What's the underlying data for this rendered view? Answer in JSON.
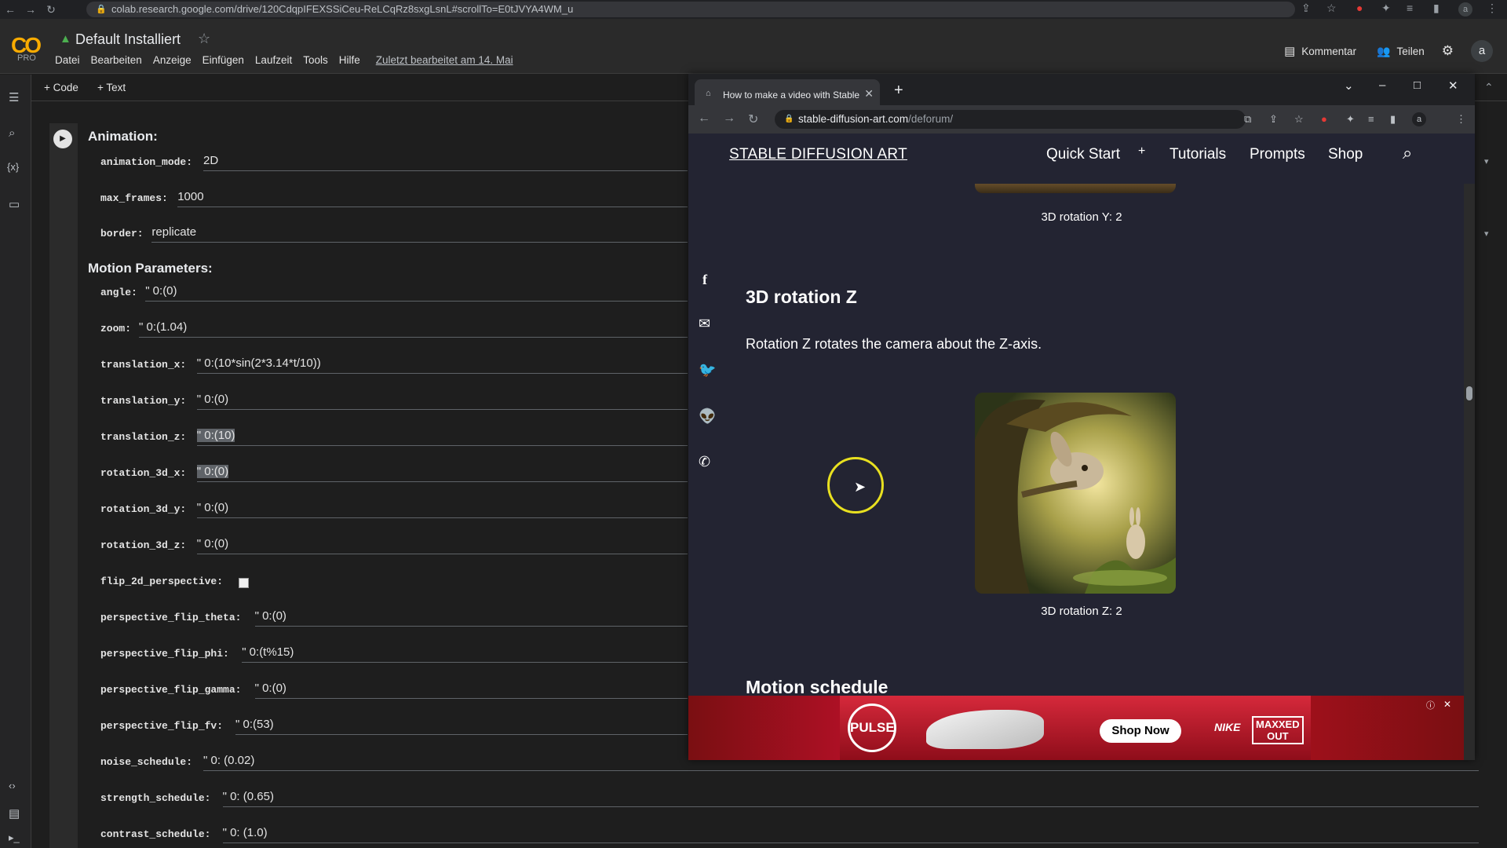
{
  "browser": {
    "url": "colab.research.google.com/drive/120CdqpIFEXSSiCeu-ReLCqRz8sxgLsnL#scrollTo=E0tJVYA4WM_u",
    "profile_initial": "a"
  },
  "colab": {
    "logo": "CO",
    "plan": "PRO",
    "notebook_title": "Default Installiert",
    "menu": [
      "Datei",
      "Bearbeiten",
      "Anzeige",
      "Einfügen",
      "Laufzeit",
      "Tools",
      "Hilfe"
    ],
    "last_edited": "Zuletzt bearbeitet am 14. Mai",
    "comment_label": "Kommentar",
    "share_label": "Teilen",
    "avatar_initial": "a",
    "toolbar": {
      "add_code": "+ Code",
      "add_text": "+ Text"
    }
  },
  "cell": {
    "animation_heading": "Animation:",
    "motion_heading": "Motion Parameters:",
    "animation_params": [
      {
        "name": "animation_mode:",
        "value": "2D"
      },
      {
        "name": "max_frames:",
        "value": "1000"
      },
      {
        "name": "border:",
        "value": "replicate"
      }
    ],
    "motion_params": [
      {
        "name": "angle:",
        "value": "\" 0:(0)"
      },
      {
        "name": "zoom:",
        "value": "\" 0:(1.04)"
      },
      {
        "name": "translation_x:",
        "value": "\" 0:(10*sin(2*3.14*t/10))"
      },
      {
        "name": "translation_y:",
        "value": "\" 0:(0)"
      },
      {
        "name": "translation_z:",
        "value": "\" 0:(10)"
      },
      {
        "name": "rotation_3d_x:",
        "value": "\" 0:(0)"
      },
      {
        "name": "rotation_3d_y:",
        "value": "\" 0:(0)"
      },
      {
        "name": "rotation_3d_z:",
        "value": "\" 0:(0)"
      },
      {
        "name": "flip_2d_perspective:",
        "value": ""
      },
      {
        "name": "perspective_flip_theta:",
        "value": "\" 0:(0)"
      },
      {
        "name": "perspective_flip_phi:",
        "value": "\" 0:(t%15)"
      },
      {
        "name": "perspective_flip_gamma:",
        "value": "\" 0:(0)"
      },
      {
        "name": "perspective_flip_fv:",
        "value": "\" 0:(53)"
      },
      {
        "name": "noise_schedule:",
        "value": "\" 0: (0.02)"
      },
      {
        "name": "strength_schedule:",
        "value": "\" 0: (0.65)"
      },
      {
        "name": "contrast_schedule:",
        "value": "\" 0: (1.0)"
      }
    ]
  },
  "popup": {
    "tab_title": "How to make a video with Stable",
    "url_host": "stable-diffusion-art.com",
    "url_path": "/deforum/",
    "site": {
      "brand": "STABLE DIFFUSION ART",
      "nav": [
        "Quick Start",
        "+",
        "Tutorials",
        "Prompts",
        "Shop"
      ],
      "caption_y": "3D rotation Y: 2",
      "heading_z": "3D rotation Z",
      "para_z": "Rotation Z rotates the camera about the Z-axis.",
      "caption_z": "3D rotation Z: 2",
      "heading_motion": "Motion schedule"
    },
    "ad": {
      "pulse_logo": "PULSE",
      "cta": "Shop Now",
      "brand": "NIKE",
      "maxxed_top": "MAXXED",
      "maxxed_bottom": "OUT"
    }
  },
  "icons": {
    "share": [
      "facebook-icon",
      "email-icon",
      "twitter-icon",
      "reddit-icon",
      "whatsapp-icon"
    ]
  }
}
